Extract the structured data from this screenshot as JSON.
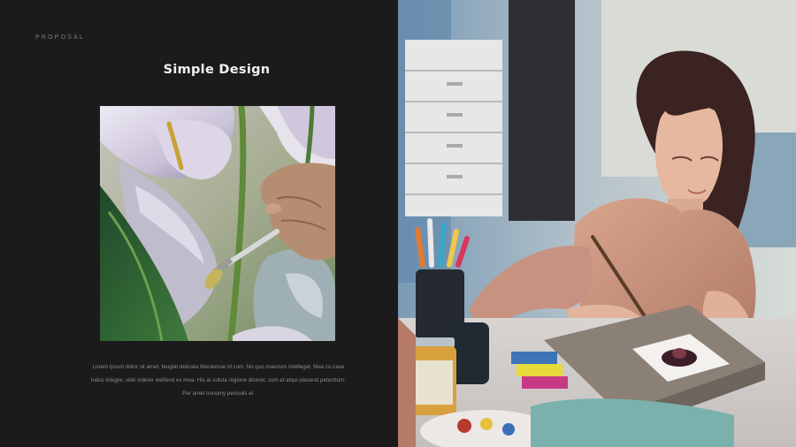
{
  "slide": {
    "eyebrow": "PROPOSAL",
    "title": "Simple Design",
    "body_lines": [
      "Lorem ipsum dolor sit amet, feugiat delicata liberavisse id cum. No quo maiorum intelleget. Mea cu case",
      "ludus integre, vide viderer eleifend ex mea. His at soluta regione diceret, cum et atqui placerat petentium.",
      "Per amet nonumy periculis ei."
    ]
  },
  "images": {
    "left_photo": "painting-flower-with-brush",
    "right_photo": "woman-painting-at-desk"
  },
  "colors": {
    "background": "#1b1b1b",
    "title": "#f2f2f2",
    "eyebrow": "#7c7c7c",
    "body_text": "#8b8b8b"
  }
}
